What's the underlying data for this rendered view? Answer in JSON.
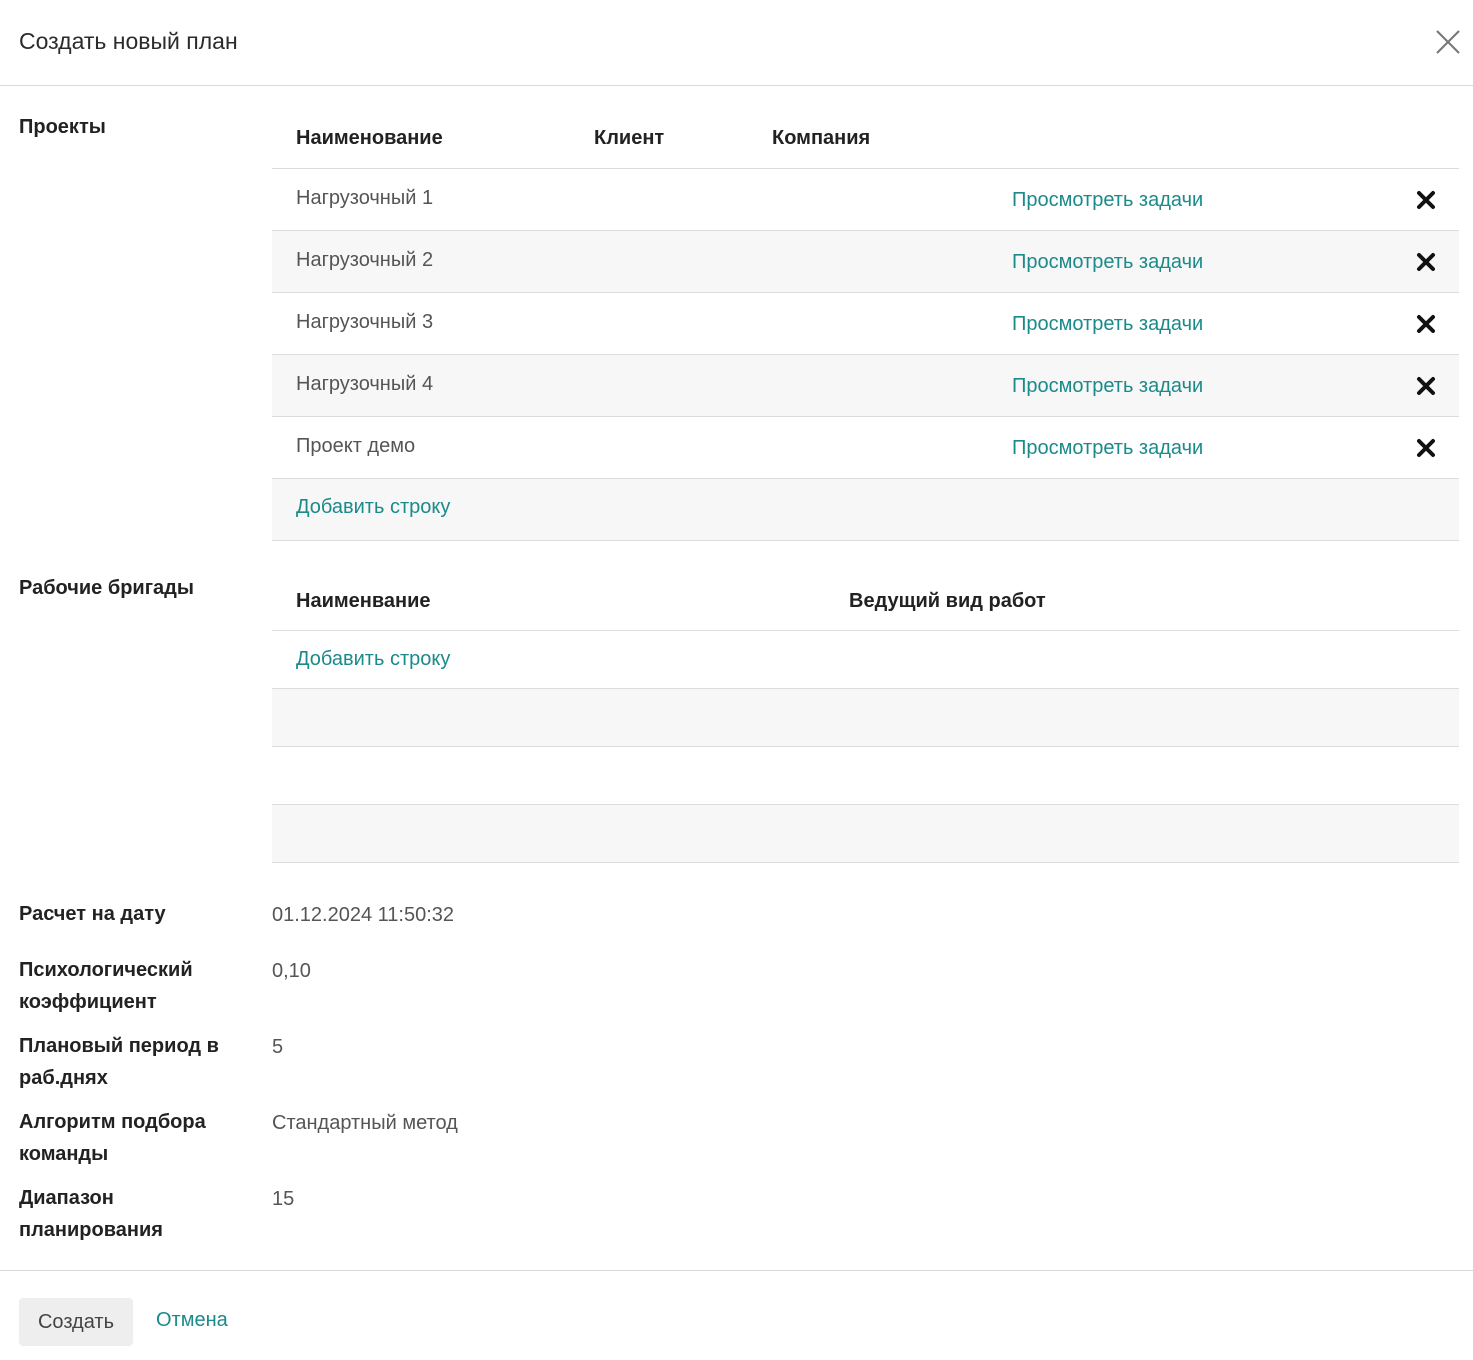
{
  "dialog": {
    "title": "Создать новый план",
    "close_icon": "close-icon"
  },
  "projects": {
    "label": "Проекты",
    "columns": [
      "Наименование",
      "Клиент",
      "Компания"
    ],
    "rows": [
      {
        "name": "Нагрузочный 1",
        "link": "Просмотреть задачи"
      },
      {
        "name": "Нагрузочный 2",
        "link": "Просмотреть задачи"
      },
      {
        "name": "Нагрузочный 3",
        "link": "Просмотреть задачи"
      },
      {
        "name": "Нагрузочный 4",
        "link": "Просмотреть задачи"
      },
      {
        "name": "Проект демо",
        "link": "Просмотреть задачи"
      }
    ],
    "add_row": "Добавить строку",
    "delete_icon": "delete-row-icon"
  },
  "brigades": {
    "label": "Рабочие бригады",
    "columns": [
      "Наименвание",
      "Ведущий вид работ"
    ],
    "add_row": "Добавить строку"
  },
  "fields": [
    {
      "label": "Расчет на дату",
      "value": "01.12.2024 11:50:32"
    },
    {
      "label": "Психологический коэффициент",
      "value": "0,10"
    },
    {
      "label": "Плановый период в раб.днях",
      "value": "5"
    },
    {
      "label": "Алгоритм подбора команды",
      "value": "Стандартный метод"
    },
    {
      "label": "Диапазон планирования",
      "value": "15"
    }
  ],
  "footer": {
    "create_label": "Создать",
    "cancel_label": "Отмена"
  },
  "colors": {
    "link": "#1b8a8a",
    "row_alt": "#f7f7f7",
    "border": "#dcdcdc"
  }
}
